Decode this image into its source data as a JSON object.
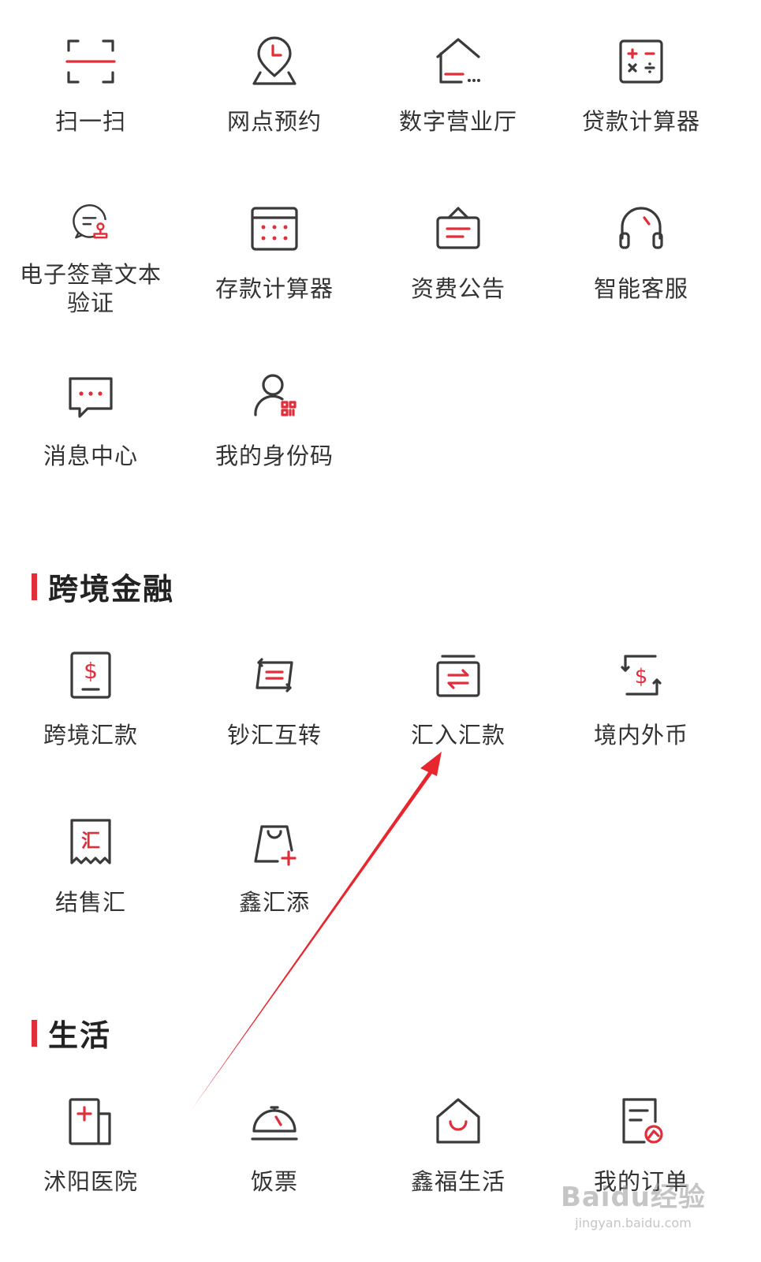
{
  "services": [
    {
      "label": "扫一扫",
      "icon": "scan-icon"
    },
    {
      "label": "网点预约",
      "icon": "location-clock-icon"
    },
    {
      "label": "数字营业厅",
      "icon": "house-icon"
    },
    {
      "label": "贷款计算器",
      "icon": "calculator-icon"
    },
    {
      "label": "电子签章文本验证",
      "icon": "document-stamp-icon"
    },
    {
      "label": "存款计算器",
      "icon": "calendar-grid-icon"
    },
    {
      "label": "资费公告",
      "icon": "notice-board-icon"
    },
    {
      "label": "智能客服",
      "icon": "headset-icon"
    },
    {
      "label": "消息中心",
      "icon": "message-bubble-icon"
    },
    {
      "label": "我的身份码",
      "icon": "user-qrcode-icon"
    }
  ],
  "cross_border": {
    "title": "跨境金融",
    "items": [
      {
        "label": "跨境汇款",
        "icon": "dollar-document-icon"
      },
      {
        "label": "钞汇互转",
        "icon": "exchange-cycle-icon"
      },
      {
        "label": "汇入汇款",
        "icon": "transfer-arrows-icon"
      },
      {
        "label": "境内外币",
        "icon": "dollar-refresh-icon"
      },
      {
        "label": "结售汇",
        "icon": "receipt-hui-icon"
      },
      {
        "label": "鑫汇添",
        "icon": "shopping-bag-plus-icon"
      }
    ]
  },
  "life": {
    "title": "生活",
    "items": [
      {
        "label": "沭阳医院",
        "icon": "hospital-icon"
      },
      {
        "label": "饭票",
        "icon": "dining-bell-icon"
      },
      {
        "label": "鑫福生活",
        "icon": "smile-house-icon"
      },
      {
        "label": "我的订单",
        "icon": "order-document-icon"
      }
    ]
  },
  "annotation": {
    "color": "#e8262e"
  },
  "watermark": {
    "line1": "Baidu经验",
    "line2": "jingyan.baidu.com"
  },
  "colors": {
    "accent": "#e02e3a",
    "icon_stroke": "#3a3a3a",
    "text": "#333333"
  }
}
